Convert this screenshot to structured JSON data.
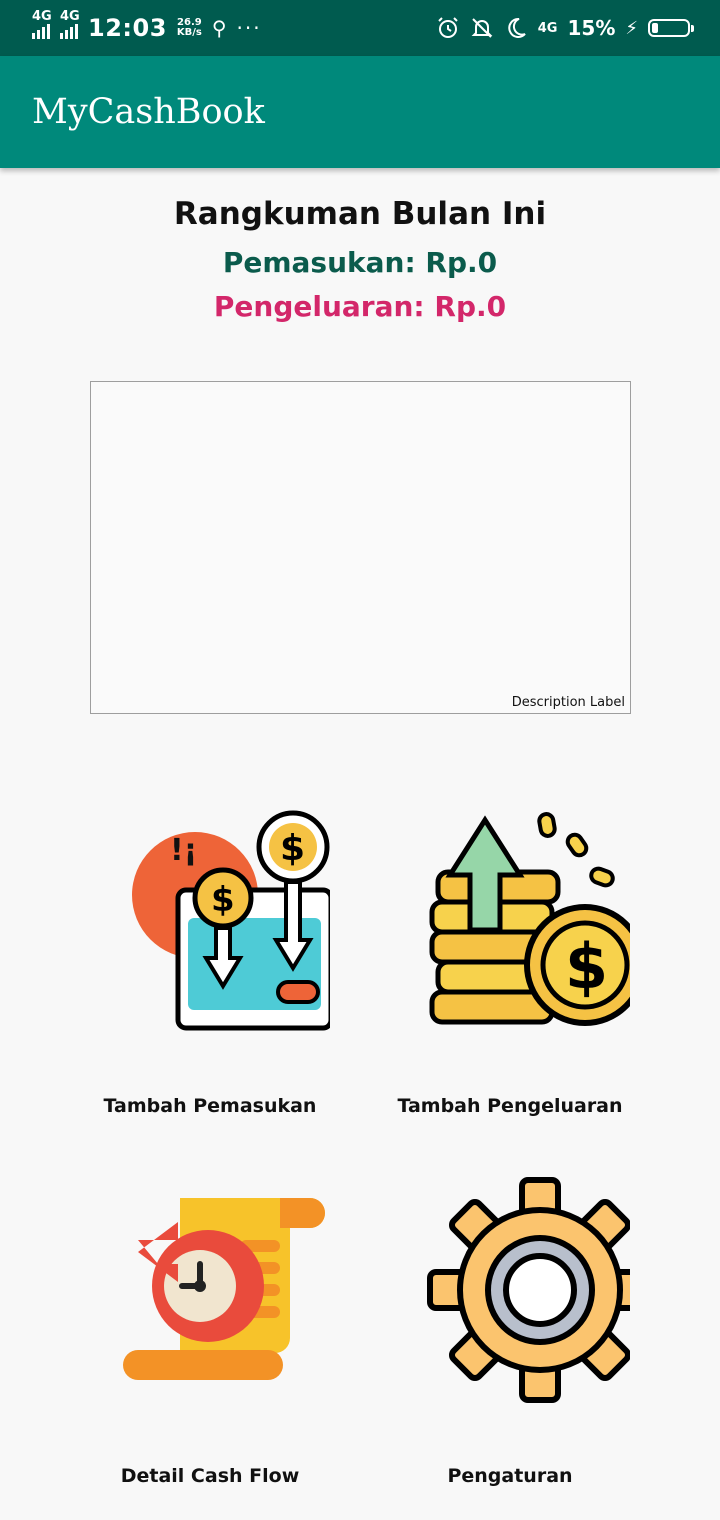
{
  "statusbar": {
    "network1": "4G",
    "network2": "4G",
    "time": "12:03",
    "speed_value": "26.9",
    "speed_unit": "KB/s",
    "more": "···",
    "net_right": "4G",
    "battery_percent": "15%"
  },
  "appbar": {
    "title": "MyCashBook"
  },
  "summary": {
    "title": "Rangkuman Bulan Ini",
    "income": "Pemasukan: Rp.0",
    "expense": "Pengeluaran: Rp.0"
  },
  "chart": {
    "description_label": "Description Label"
  },
  "menu": {
    "add_income": "Tambah Pemasukan",
    "add_expense": "Tambah Pengeluaran",
    "cash_flow_detail": "Detail Cash Flow",
    "settings": "Pengaturan"
  },
  "colors": {
    "statusbar": "#005b4f",
    "appbar": "#00897b",
    "income_text": "#0b5b4c",
    "expense_text": "#d3276a"
  },
  "icons": {
    "add_income": "wallet-coin-in-icon",
    "add_expense": "coins-arrow-up-icon",
    "cash_flow_detail": "scroll-clock-icon",
    "settings": "gear-icon"
  }
}
